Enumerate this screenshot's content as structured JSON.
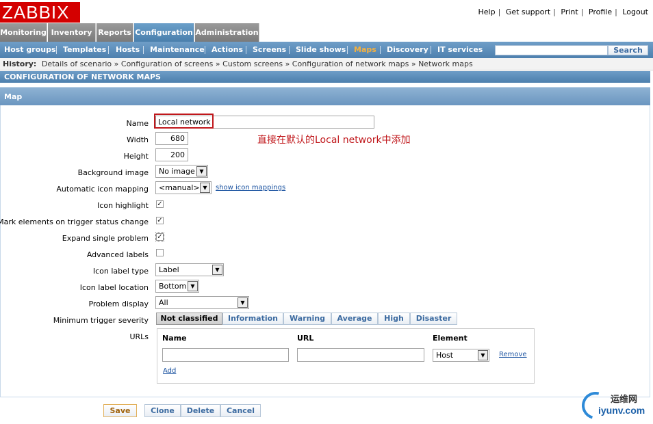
{
  "logo": "ZABBIX",
  "toplinks": [
    "Help",
    "Get support",
    "Print",
    "Profile",
    "Logout"
  ],
  "mainmenu": [
    "Monitoring",
    "Inventory",
    "Reports",
    "Configuration",
    "Administration"
  ],
  "submenu": [
    "Host groups",
    "Templates",
    "Hosts",
    "Maintenance",
    "Actions",
    "Screens",
    "Slide shows",
    "Maps",
    "Discovery",
    "IT services"
  ],
  "search": {
    "button": "Search",
    "value": ""
  },
  "history": {
    "label": "History:",
    "items": [
      "Details of scenario",
      "Configuration of screens",
      "Custom screens",
      "Configuration of network maps",
      "Network maps"
    ],
    "sep": "»"
  },
  "section_title": "CONFIGURATION OF NETWORK MAPS",
  "map_header": "Map",
  "form": {
    "name_label": "Name",
    "name_value": "Local network",
    "width_label": "Width",
    "width_value": "680",
    "height_label": "Height",
    "height_value": "200",
    "bg_label": "Background image",
    "bg_value": "No image",
    "aim_label": "Automatic icon mapping",
    "aim_value": "<manual>",
    "aim_link": "show icon mappings",
    "icon_highlight_label": "Icon highlight",
    "mark_label": "Mark elements on trigger status change",
    "expand_label": "Expand single problem",
    "advanced_label": "Advanced labels",
    "ilt_label": "Icon label type",
    "ilt_value": "Label",
    "ill_label": "Icon label location",
    "ill_value": "Bottom",
    "pd_label": "Problem display",
    "pd_value": "All",
    "mts_label": "Minimum trigger severity",
    "severities": [
      "Not classified",
      "Information",
      "Warning",
      "Average",
      "High",
      "Disaster"
    ],
    "urls_label": "URLs",
    "url_cols": [
      "Name",
      "URL",
      "Element"
    ],
    "element_value": "Host",
    "remove": "Remove",
    "add": "Add"
  },
  "checks": {
    "icon_highlight": true,
    "mark": true,
    "expand": true,
    "advanced": false
  },
  "annotation": "直接在默认的Local network中添加",
  "buttons": {
    "save": "Save",
    "clone": "Clone",
    "delete": "Delete",
    "cancel": "Cancel"
  },
  "watermark": {
    "top": "运维网",
    "bottom": "iyunv.com"
  }
}
